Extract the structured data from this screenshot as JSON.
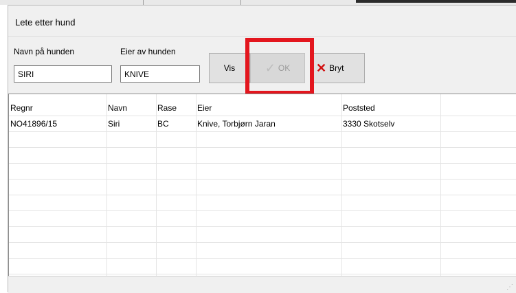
{
  "dialog": {
    "title": "Lete etter hund"
  },
  "search": {
    "name_label": "Navn på hunden",
    "name_value": "SIRI",
    "owner_label": "Eier av hunden",
    "owner_value": "KNIVE"
  },
  "buttons": {
    "vis": "Vis",
    "ok": "OK",
    "bryt": "Bryt"
  },
  "grid": {
    "columns": [
      "Regnr",
      "Navn",
      "Rase",
      "Eier",
      "Poststed"
    ],
    "rows": [
      [
        "NO41896/15",
        "Siri",
        "BC",
        "Knive, Torbjørn Jaran",
        "3330 Skotselv"
      ]
    ]
  },
  "colors": {
    "highlight": "#e3161e",
    "cancel_icon": "#d10f0f"
  },
  "icons": {
    "ok": "checkmark-icon",
    "bryt": "x-icon"
  }
}
